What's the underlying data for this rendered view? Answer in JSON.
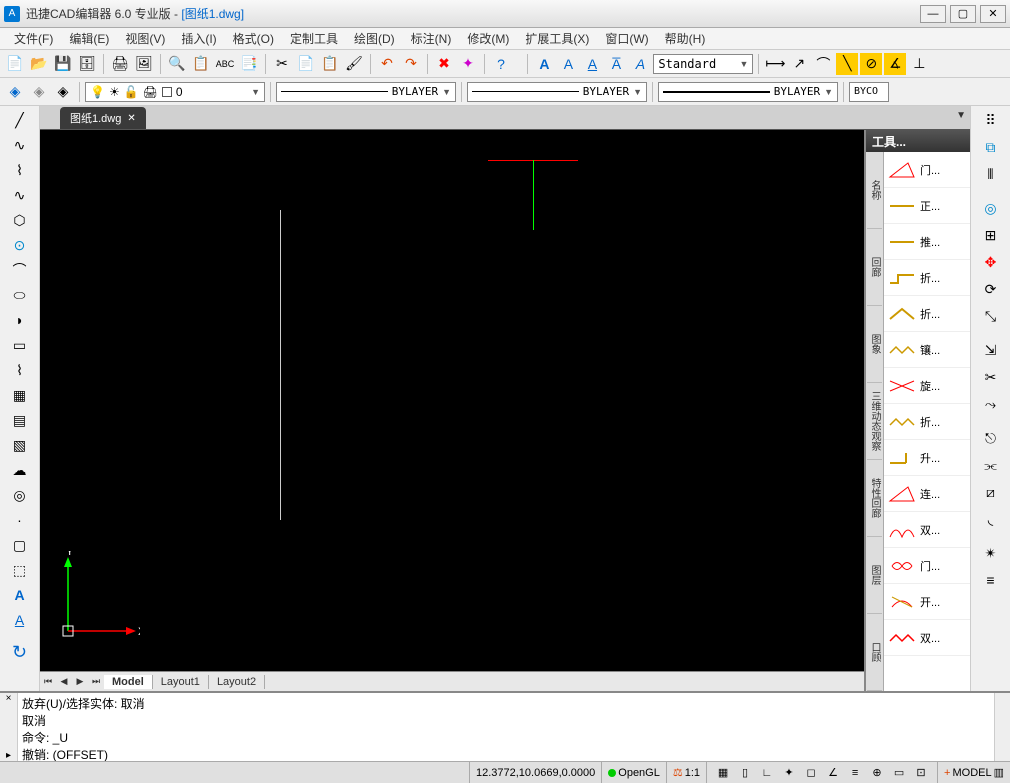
{
  "title": {
    "app": "迅捷CAD编辑器 6.0 专业版  - ",
    "doc": "[图纸1.dwg]"
  },
  "menu": [
    "文件(F)",
    "编辑(E)",
    "视图(V)",
    "插入(I)",
    "格式(O)",
    "定制工具",
    "绘图(D)",
    "标注(N)",
    "修改(M)",
    "扩展工具(X)",
    "窗口(W)",
    "帮助(H)"
  ],
  "text_style": "Standard",
  "layer_name": "0",
  "linetype1": "BYLAYER",
  "linetype2": "BYLAYER",
  "linetype3": "BYLAYER",
  "bycolor": "BYCO",
  "doc_tab": "图纸1.dwg",
  "layouts": {
    "model": "Model",
    "l1": "Layout1",
    "l2": "Layout2"
  },
  "axis": {
    "x": "X",
    "y": "Y"
  },
  "palette_title": "工具...",
  "palette_side": [
    "名称",
    "回廊",
    "图象",
    "三维动态观察",
    "特性回廊",
    "图层",
    "口顾"
  ],
  "palette_items": [
    {
      "label": "门..."
    },
    {
      "label": "正..."
    },
    {
      "label": "推..."
    },
    {
      "label": "折..."
    },
    {
      "label": "折..."
    },
    {
      "label": "镶..."
    },
    {
      "label": "旋..."
    },
    {
      "label": "折..."
    },
    {
      "label": "升..."
    },
    {
      "label": "连..."
    },
    {
      "label": "双..."
    },
    {
      "label": "门..."
    },
    {
      "label": "开..."
    },
    {
      "label": "双..."
    }
  ],
  "cmd_lines": "放弃(U)/选择实体: 取消\n取消\n命令:  _U\n撤销: (OFFSET)\n命令: ",
  "status": {
    "coords": "12.3772,10.0669,0.0000",
    "opengl": "OpenGL",
    "scale": "1:1",
    "model": "MODEL"
  }
}
